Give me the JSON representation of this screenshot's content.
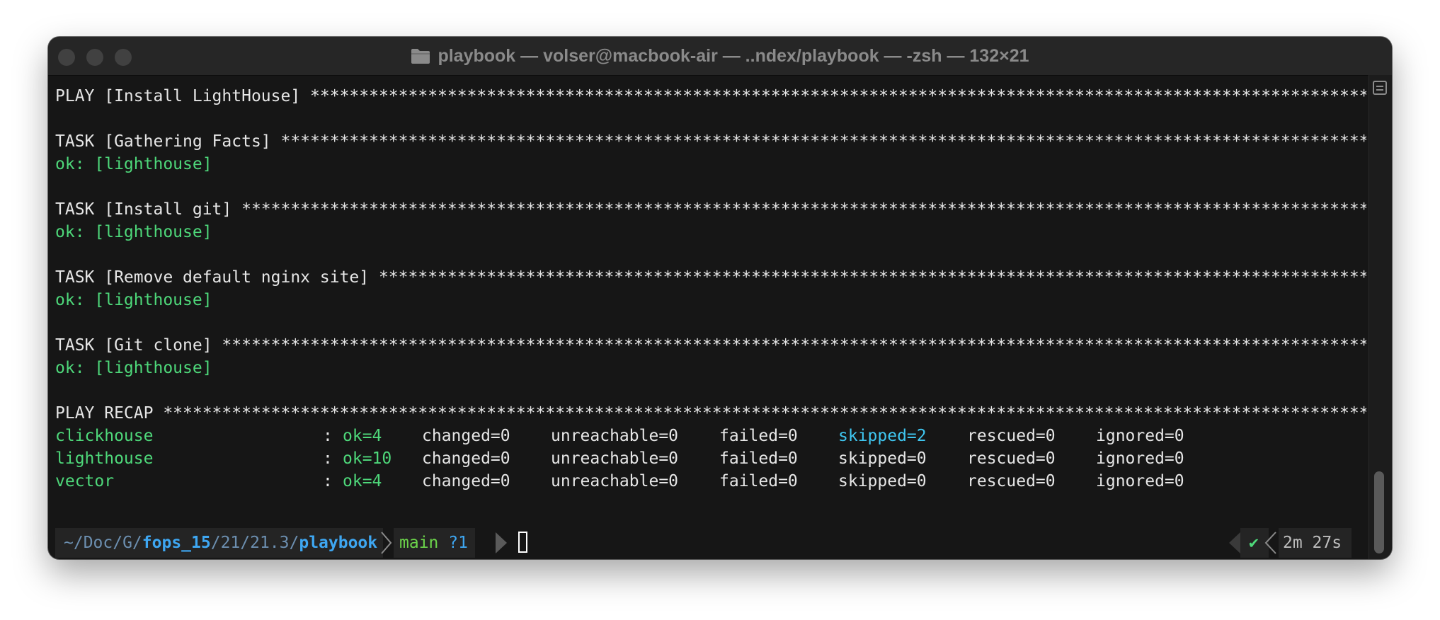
{
  "window": {
    "title": "playbook — volser@macbook-air — ..ndex/playbook — -zsh — 132×21"
  },
  "icons": {
    "folder": "folder-icon",
    "scroll_toggle": "scrollback-toggle-icon",
    "check": "check-icon"
  },
  "output": {
    "play1": "PLAY [Install LightHouse] ******************************************************************************************************************",
    "task1": "TASK [Gathering Facts] *********************************************************************************************************************",
    "ok1": "ok: [lighthouse]",
    "task2": "TASK [Install git] *************************************************************************************************************************",
    "ok2": "ok: [lighthouse]",
    "task3": "TASK [Remove default nginx site] ***********************************************************************************************************",
    "ok3": "ok: [lighthouse]",
    "task4": "TASK [Git clone] ***************************************************************************************************************************",
    "ok4": "ok: [lighthouse]",
    "recap": "PLAY RECAP *********************************************************************************************************************************"
  },
  "recap": [
    {
      "host": "clickhouse",
      "sep": ":",
      "ok": "ok=4",
      "changed": "changed=0",
      "unreachable": "unreachable=0",
      "failed": "failed=0",
      "skipped": "skipped=2",
      "rescued": "rescued=0",
      "ignored": "ignored=0"
    },
    {
      "host": "lighthouse",
      "sep": ":",
      "ok": "ok=10",
      "changed": "changed=0",
      "unreachable": "unreachable=0",
      "failed": "failed=0",
      "skipped": "skipped=0",
      "rescued": "rescued=0",
      "ignored": "ignored=0"
    },
    {
      "host": "vector",
      "sep": ":",
      "ok": "ok=4",
      "changed": "changed=0",
      "unreachable": "unreachable=0",
      "failed": "failed=0",
      "skipped": "skipped=0",
      "rescued": "rescued=0",
      "ignored": "ignored=0"
    }
  ],
  "prompt": {
    "path_prefix": "~/Doc/G/",
    "path_bold1": "fops_15",
    "path_mid": "/21/21.3/",
    "path_bold2": "playbook",
    "branch": "main",
    "git_status": "?1",
    "check": "✔",
    "duration": "2m 27s"
  },
  "colors": {
    "background": "#161616",
    "titlebar": "#262626",
    "green": "#4ed87a",
    "cyan": "#3fc6f0",
    "path_blue": "#3ea7f2",
    "branch_green": "#6cd44b"
  }
}
